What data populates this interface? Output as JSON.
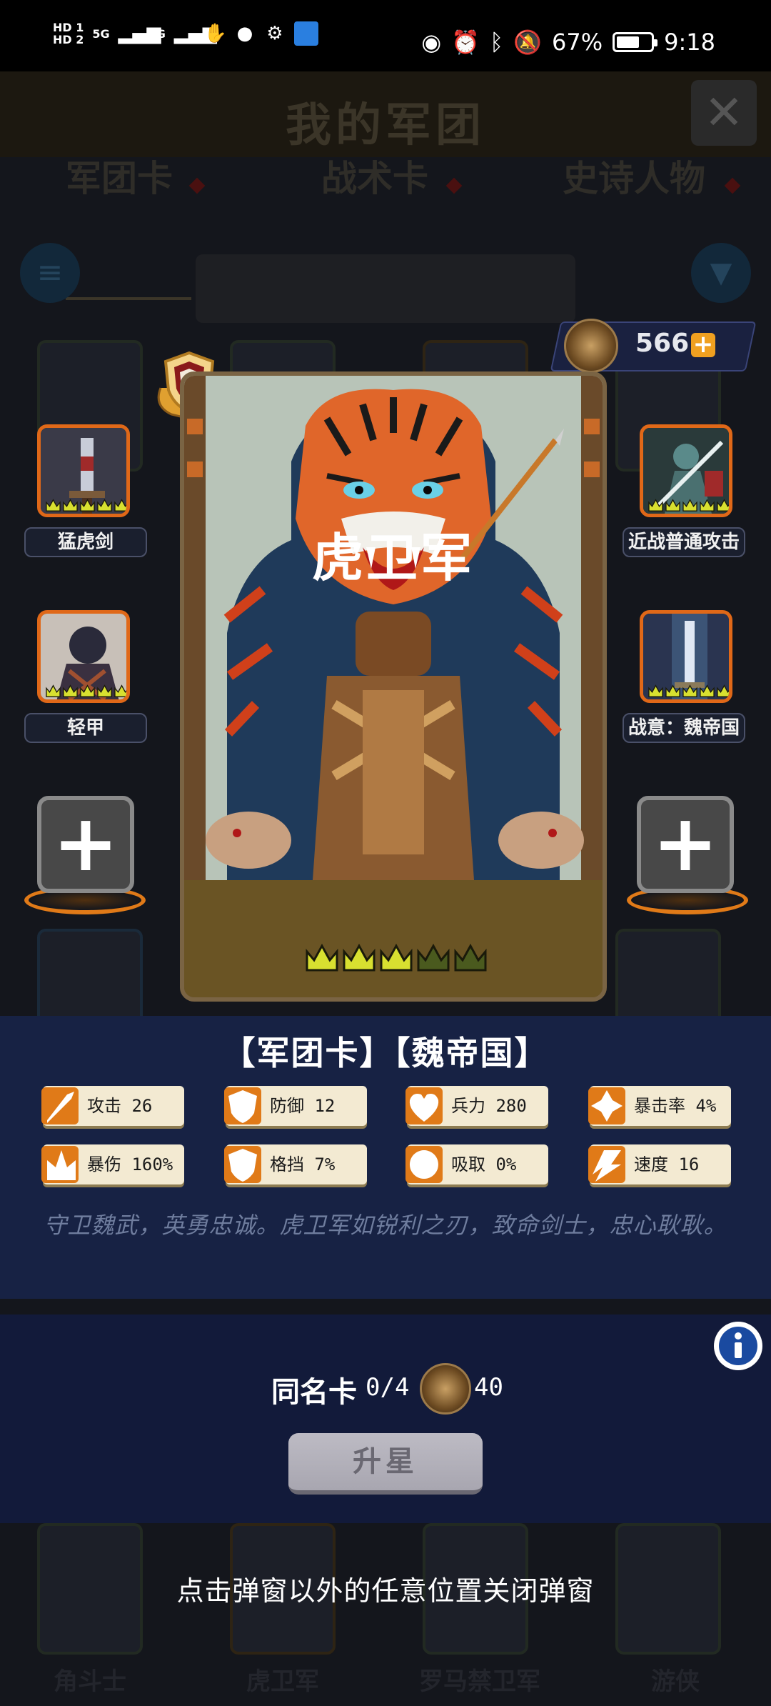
{
  "status_bar": {
    "hd1": "HD 1",
    "hd2": "HD 2",
    "network1": "5G",
    "network2": "4G",
    "battery_percent": "67%",
    "battery_level": 0.67,
    "time": "9:18",
    "icons": [
      "signal-icon",
      "hand-icon",
      "chat-icon",
      "settings-icon",
      "app-icon",
      "eye-icon",
      "alarm-icon",
      "bluetooth-icon",
      "mute-icon",
      "battery-icon"
    ]
  },
  "background": {
    "title": "我的军团",
    "tabs": [
      "军团卡",
      "战术卡",
      "史诗人物"
    ],
    "grid_names_visible": [
      "角斗士",
      "虎卫军",
      "罗马禁卫军",
      "游侠"
    ]
  },
  "currency": {
    "value": "566",
    "plus": "+"
  },
  "card": {
    "name": "虎卫军",
    "stars_filled": 3,
    "stars_total": 5,
    "type_line": "【军团卡】【魏帝国】"
  },
  "slots": {
    "left_top": "猛虎剑",
    "left_mid": "轻甲",
    "right_top": "近战普通攻击",
    "right_mid": "战意：魏帝国",
    "add_symbol": "+"
  },
  "stats": [
    {
      "icon": "sword-icon",
      "label": "攻击 26"
    },
    {
      "icon": "shield-icon",
      "label": "防御 12"
    },
    {
      "icon": "heart-icon",
      "label": "兵力 280"
    },
    {
      "icon": "crit-icon",
      "label": "暴击率 4%"
    },
    {
      "icon": "crit-damage-icon",
      "label": "暴伤 160%"
    },
    {
      "icon": "block-icon",
      "label": "格挡 7%"
    },
    {
      "icon": "lifesteal-icon",
      "label": "吸取 0%"
    },
    {
      "icon": "speed-icon",
      "label": "速度 16"
    }
  ],
  "description": "守卫魏武，英勇忠诚。虎卫军如锐利之刃，致命剑士，忠心耿耿。",
  "upgrade": {
    "dup_label": "同名卡",
    "dup_count": "0/4",
    "cost": "40",
    "button": "升星"
  },
  "close_hint": "点击弹窗以外的任意位置关闭弹窗",
  "colors": {
    "panel": "#172244",
    "slot_border": "#e06818",
    "crown_filled": "#d8e030",
    "crown_empty": "#4a5a1e",
    "stat_bg": "#f3ead2",
    "stat_icon": "#e07a18"
  }
}
